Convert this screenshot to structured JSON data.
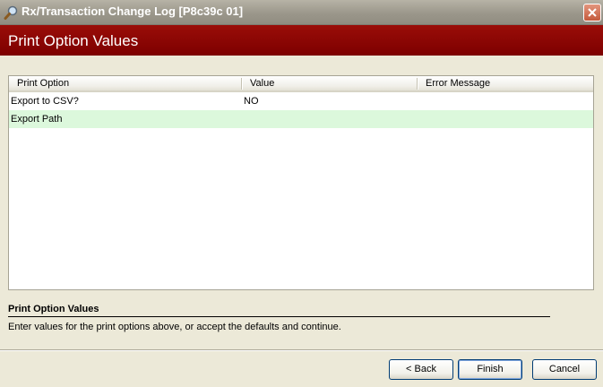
{
  "window": {
    "title": "Rx/Transaction Change Log [P8c39c 01]",
    "icon": "magnifier-icon",
    "close_icon": "close-icon"
  },
  "header": {
    "title": "Print Option Values",
    "background_color": "#8b0000"
  },
  "grid": {
    "columns": [
      "Print Option",
      "Value",
      "Error Message"
    ],
    "rows": [
      {
        "print_option": "Export to CSV?",
        "value": "NO",
        "error_message": ""
      },
      {
        "print_option": "Export Path",
        "value": "",
        "error_message": ""
      }
    ],
    "alt_row_color": "#dcf8dc"
  },
  "info": {
    "title": "Print Option Values",
    "text": "Enter values for the print options above, or accept the defaults and continue."
  },
  "buttons": {
    "back": "< Back",
    "finish": "Finish",
    "cancel": "Cancel"
  }
}
